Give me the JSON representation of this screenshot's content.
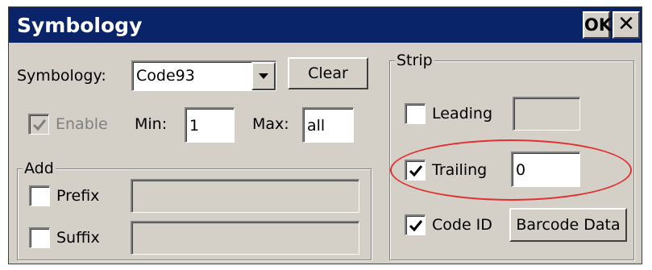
{
  "window": {
    "title": "Symbology",
    "ok_label": "OK",
    "close_icon": "close-icon"
  },
  "symbology": {
    "label": "Symbology:",
    "selected": "Code93"
  },
  "clear_label": "Clear",
  "enable": {
    "label": "Enable",
    "checked": true,
    "disabled": true
  },
  "min": {
    "label": "Min:",
    "value": "1"
  },
  "max": {
    "label": "Max:",
    "value": "all"
  },
  "add": {
    "title": "Add",
    "prefix": {
      "label": "Prefix",
      "checked": false,
      "value": ""
    },
    "suffix": {
      "label": "Suffix",
      "checked": false,
      "value": ""
    }
  },
  "strip": {
    "title": "Strip",
    "leading": {
      "label": "Leading",
      "checked": false,
      "value": ""
    },
    "trailing": {
      "label": "Trailing",
      "checked": true,
      "value": "0"
    },
    "code_id": {
      "label": "Code ID",
      "checked": true
    },
    "barcode_data_label": "Barcode Data"
  },
  "colors": {
    "titlebar": "#0a246a",
    "face": "#d4d0c8",
    "highlight_ellipse": "#e03030"
  }
}
